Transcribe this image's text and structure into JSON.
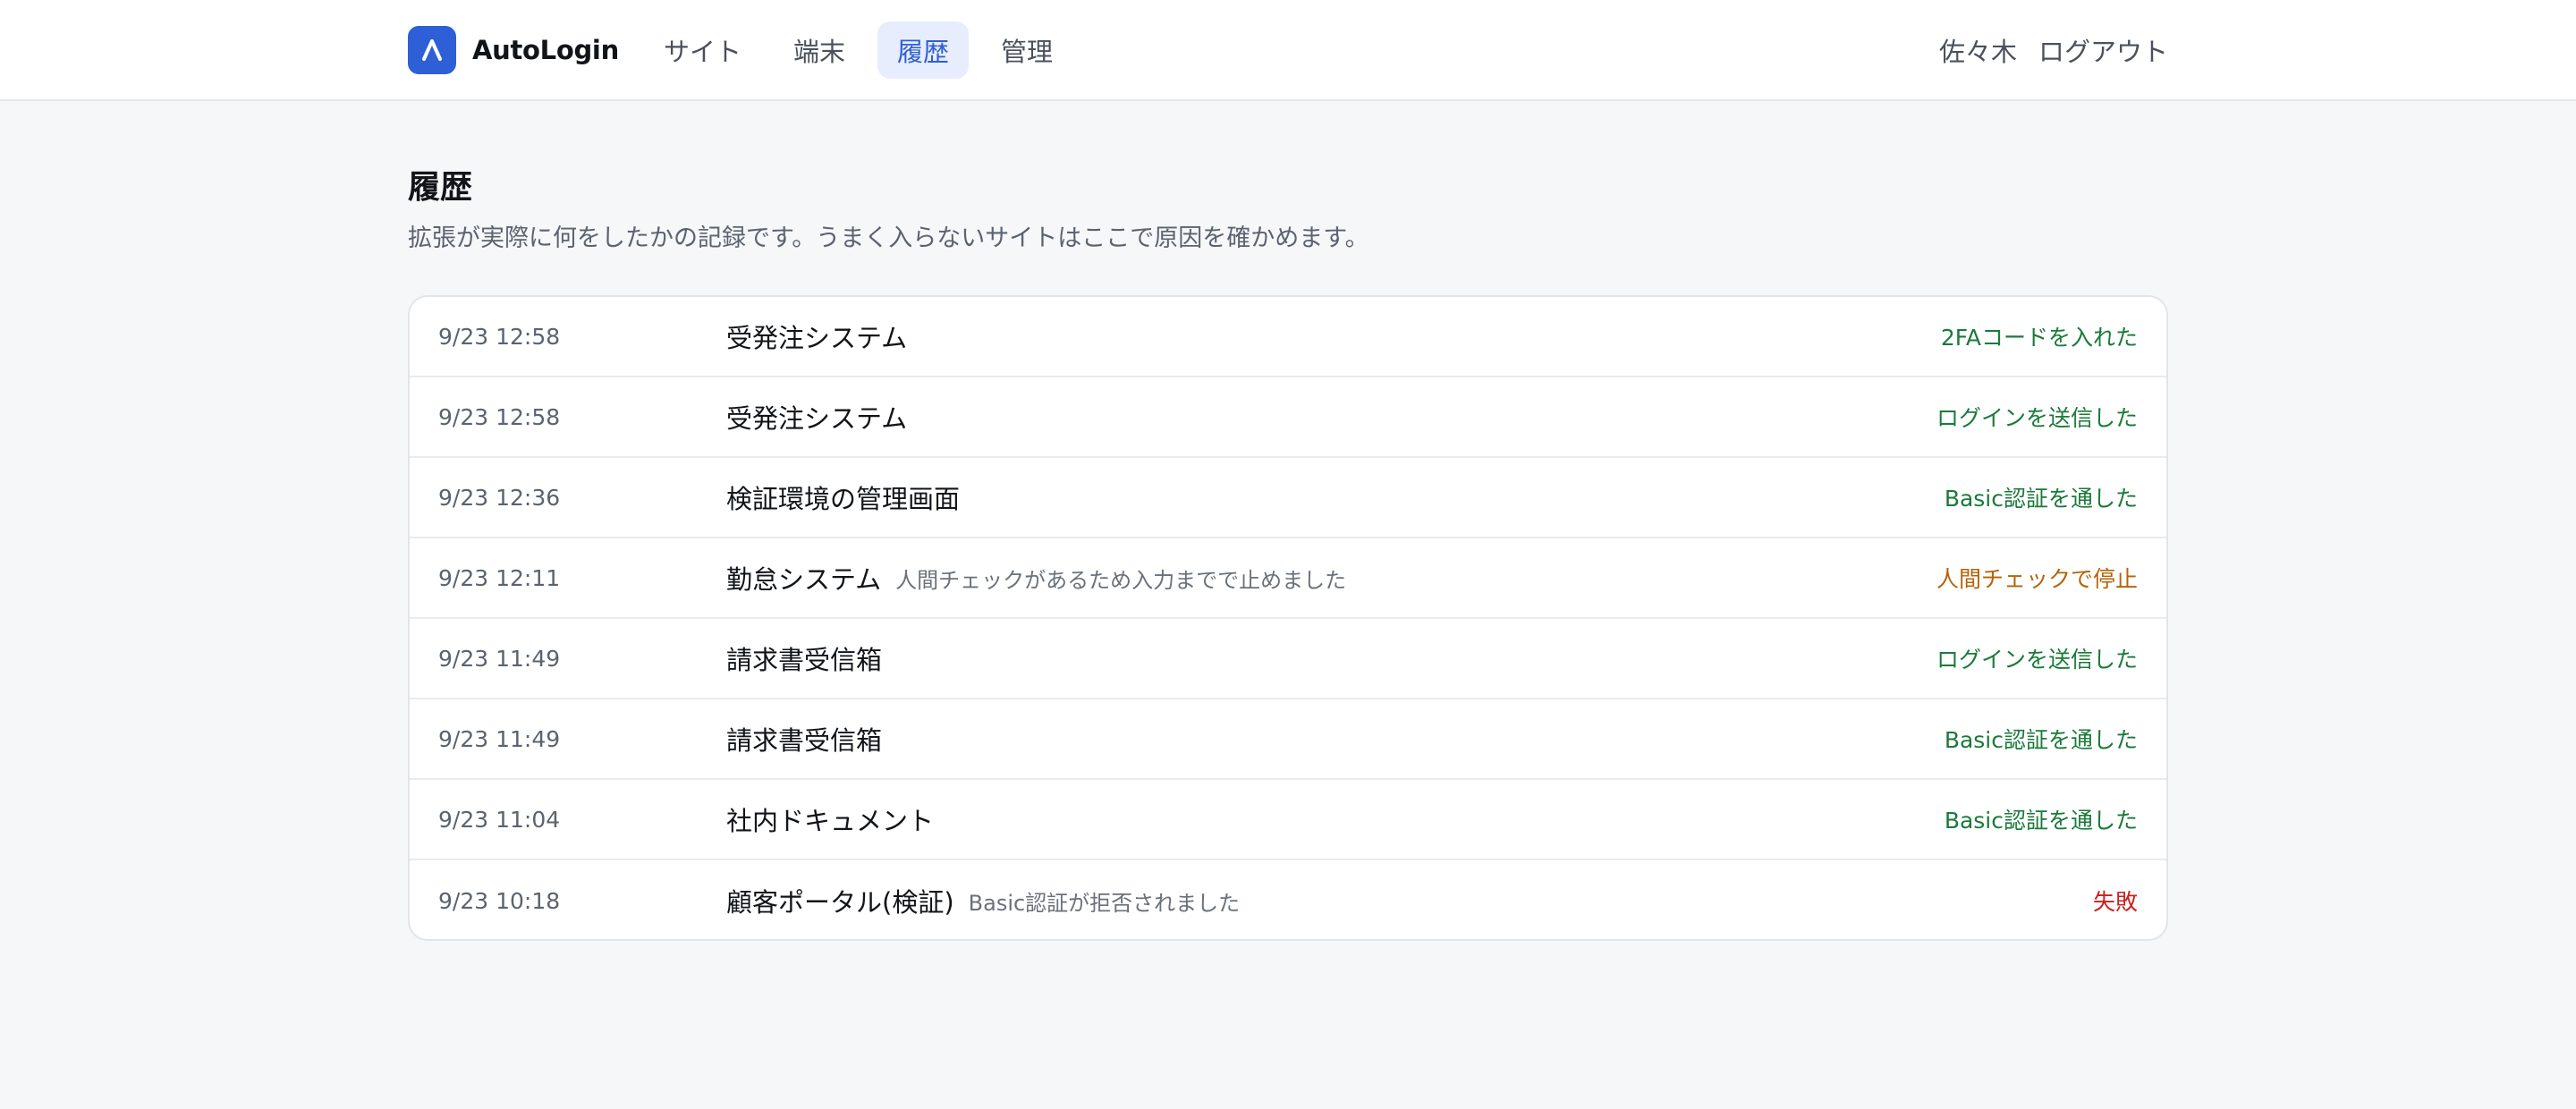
{
  "app": {
    "name": "AutoLogin"
  },
  "nav": {
    "items": [
      {
        "label": "サイト",
        "active": false
      },
      {
        "label": "端末",
        "active": false
      },
      {
        "label": "履歴",
        "active": true
      },
      {
        "label": "管理",
        "active": false
      }
    ]
  },
  "user": {
    "name": "佐々木",
    "logout_label": "ログアウト"
  },
  "page": {
    "title": "履歴",
    "description": "拡張が実際に何をしたかの記録です。うまく入らないサイトはここで原因を確かめます。"
  },
  "history": [
    {
      "time": "9/23 12:58",
      "site": "受発注システム",
      "note": "",
      "status": "2FAコードを入れた",
      "status_type": "success"
    },
    {
      "time": "9/23 12:58",
      "site": "受発注システム",
      "note": "",
      "status": "ログインを送信した",
      "status_type": "success"
    },
    {
      "time": "9/23 12:36",
      "site": "検証環境の管理画面",
      "note": "",
      "status": "Basic認証を通した",
      "status_type": "success"
    },
    {
      "time": "9/23 12:11",
      "site": "勤怠システム",
      "note": "人間チェックがあるため入力までで止めました",
      "status": "人間チェックで停止",
      "status_type": "warning"
    },
    {
      "time": "9/23 11:49",
      "site": "請求書受信箱",
      "note": "",
      "status": "ログインを送信した",
      "status_type": "success"
    },
    {
      "time": "9/23 11:49",
      "site": "請求書受信箱",
      "note": "",
      "status": "Basic認証を通した",
      "status_type": "success"
    },
    {
      "time": "9/23 11:04",
      "site": "社内ドキュメント",
      "note": "",
      "status": "Basic認証を通した",
      "status_type": "success"
    },
    {
      "time": "9/23 10:18",
      "site": "顧客ポータル(検証)",
      "note": "Basic認証が拒否されました",
      "status": "失敗",
      "status_type": "error"
    }
  ],
  "colors": {
    "accent": "#2f5fd6",
    "success": "#1b7a3a",
    "warning": "#b46307",
    "error": "#cc1f1f"
  },
  "icons": {
    "logo": "letter-a-logo-icon"
  }
}
